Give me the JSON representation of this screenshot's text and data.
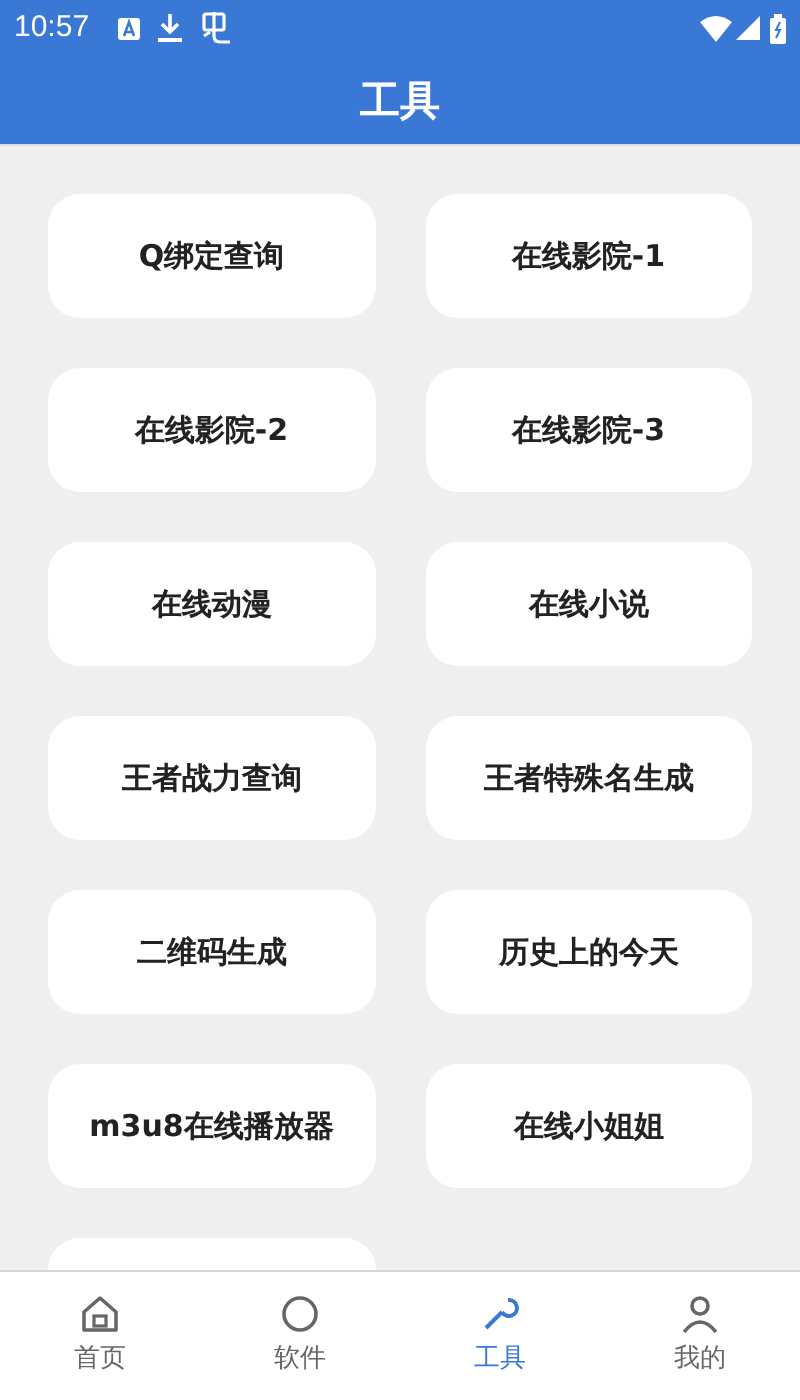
{
  "status_bar": {
    "time": "10:57"
  },
  "header": {
    "title": "工具"
  },
  "tools": [
    {
      "label": "Q绑定查询"
    },
    {
      "label": "在线影院-1"
    },
    {
      "label": "在线影院-2"
    },
    {
      "label": "在线影院-3"
    },
    {
      "label": "在线动漫"
    },
    {
      "label": "在线小说"
    },
    {
      "label": "王者战力查询"
    },
    {
      "label": "王者特殊名生成"
    },
    {
      "label": "二维码生成"
    },
    {
      "label": "历史上的今天"
    },
    {
      "label": "m3u8在线播放器"
    },
    {
      "label": "在线小姐姐"
    }
  ],
  "bottom_nav": [
    {
      "label": "首页",
      "kind": "home",
      "selected": false
    },
    {
      "label": "软件",
      "kind": "apps",
      "selected": false
    },
    {
      "label": "工具",
      "kind": "tools",
      "selected": true
    },
    {
      "label": "我的",
      "kind": "user",
      "selected": false
    }
  ]
}
